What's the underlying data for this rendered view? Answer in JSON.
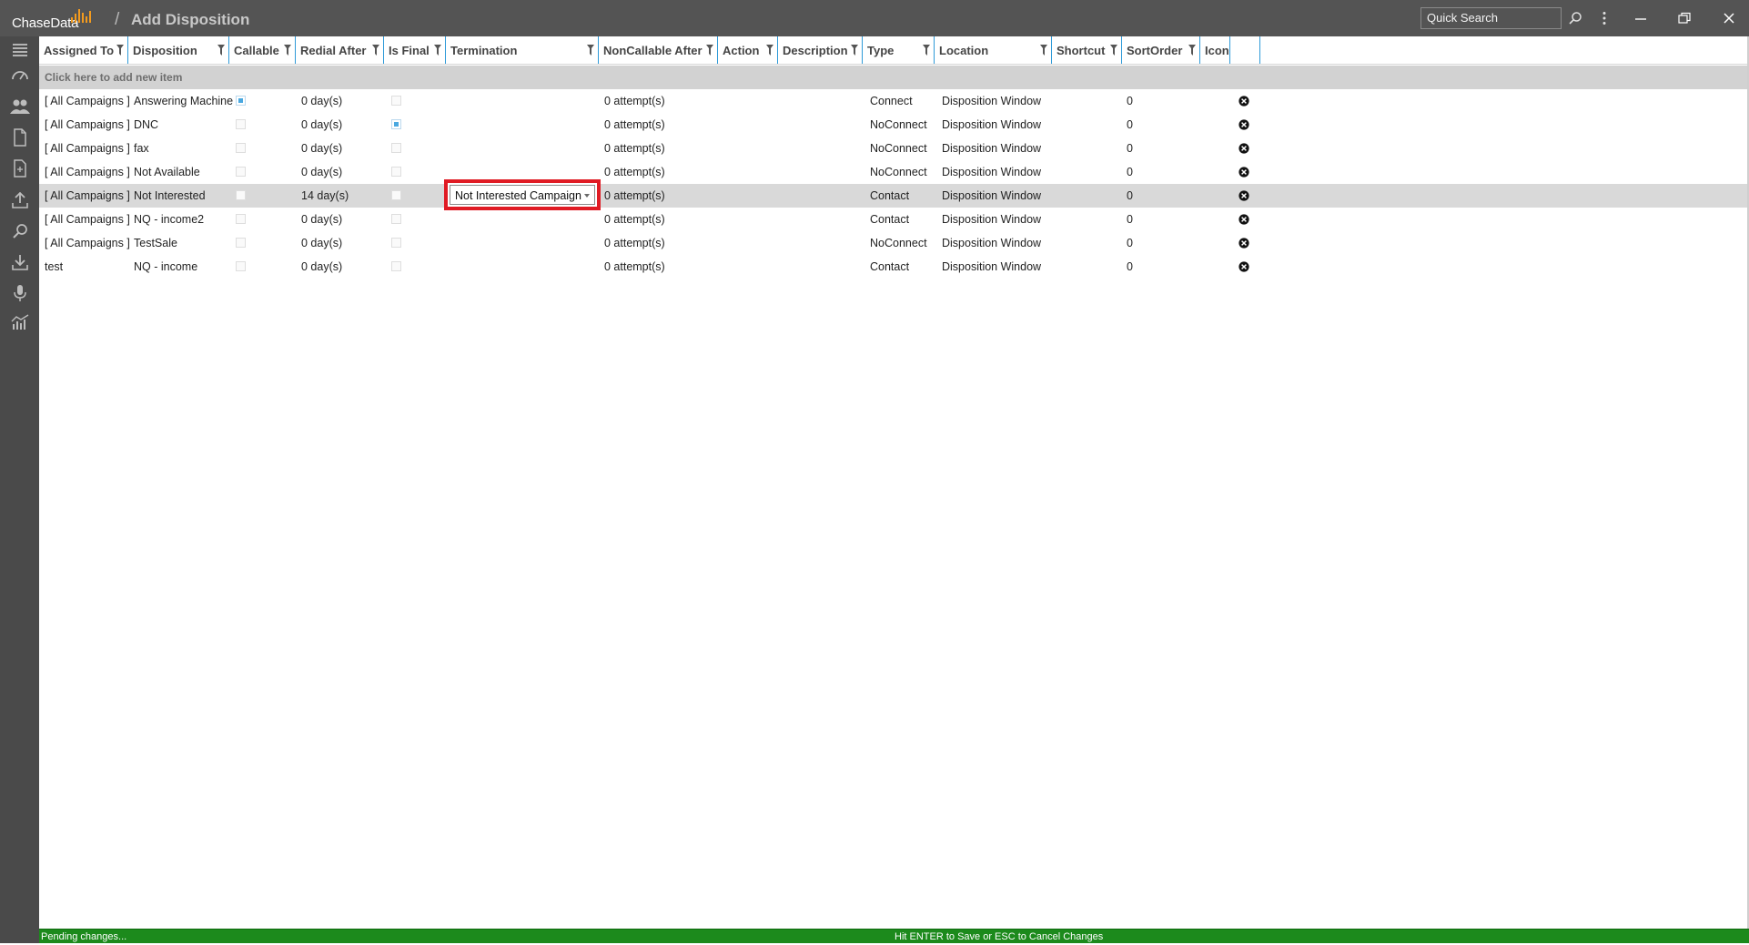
{
  "app": {
    "brand": "ChaseData",
    "breadcrumb_separator": "/",
    "page_title": "Add Disposition"
  },
  "header": {
    "quick_search_placeholder": "Quick Search"
  },
  "colors": {
    "titlebar": "#545454",
    "rail": "#4a4a4a",
    "accent_blue": "#2e9ad8",
    "highlight_red": "#e01b24",
    "status_green": "#1c8a1c",
    "logo_orange": "#f39b1e"
  },
  "rail_icons": [
    "menu-icon",
    "dashboard-icon",
    "users-icon",
    "document-icon",
    "report-icon",
    "upload-icon",
    "search-icon",
    "download-icon",
    "microphone-icon",
    "analytics-icon"
  ],
  "grid": {
    "columns": [
      "Assigned To",
      "Disposition",
      "Callable",
      "Redial After",
      "Is Final",
      "Termination",
      "NonCallable After",
      "Action",
      "Description",
      "Type",
      "Location",
      "Shortcut",
      "SortOrder",
      "Icon"
    ],
    "add_new_label": "Click here to add new item",
    "rows": [
      {
        "assigned_to": "[ All Campaigns ]",
        "disposition": "Answering Machine",
        "callable": true,
        "redial_after": "0 day(s)",
        "is_final": false,
        "termination": "",
        "noncallable_after": "0 attempt(s)",
        "type": "Connect",
        "location": "Disposition Window",
        "sort_order": "0"
      },
      {
        "assigned_to": "[ All Campaigns ]",
        "disposition": "DNC",
        "callable": false,
        "redial_after": "0 day(s)",
        "is_final": true,
        "termination": "",
        "noncallable_after": "0 attempt(s)",
        "type": "NoConnect",
        "location": "Disposition Window",
        "sort_order": "0"
      },
      {
        "assigned_to": "[ All Campaigns ]",
        "disposition": "fax",
        "callable": false,
        "redial_after": "0 day(s)",
        "is_final": false,
        "termination": "",
        "noncallable_after": "0 attempt(s)",
        "type": "NoConnect",
        "location": "Disposition Window",
        "sort_order": "0"
      },
      {
        "assigned_to": "[ All Campaigns ]",
        "disposition": "Not Available",
        "callable": false,
        "redial_after": "0 day(s)",
        "is_final": false,
        "termination": "",
        "noncallable_after": "0 attempt(s)",
        "type": "NoConnect",
        "location": "Disposition Window",
        "sort_order": "0"
      },
      {
        "assigned_to": "[ All Campaigns ]",
        "disposition": "Not Interested",
        "callable": false,
        "redial_after": "14 day(s)",
        "is_final": false,
        "termination": "Not Interested Campaign",
        "noncallable_after": "0 attempt(s)",
        "type": "Contact",
        "location": "Disposition Window",
        "sort_order": "0"
      },
      {
        "assigned_to": "[ All Campaigns ]",
        "disposition": "NQ - income2",
        "callable": false,
        "redial_after": "0 day(s)",
        "is_final": false,
        "termination": "",
        "noncallable_after": "0 attempt(s)",
        "type": "Contact",
        "location": "Disposition Window",
        "sort_order": "0"
      },
      {
        "assigned_to": "[ All Campaigns ]",
        "disposition": "TestSale",
        "callable": false,
        "redial_after": "0 day(s)",
        "is_final": false,
        "termination": "",
        "noncallable_after": "0 attempt(s)",
        "type": "NoConnect",
        "location": "Disposition Window",
        "sort_order": "0"
      },
      {
        "assigned_to": "test",
        "disposition": "NQ - income",
        "callable": false,
        "redial_after": "0 day(s)",
        "is_final": false,
        "termination": "",
        "noncallable_after": "0 attempt(s)",
        "type": "Contact",
        "location": "Disposition Window",
        "sort_order": "0"
      }
    ]
  },
  "status": {
    "left": "Pending changes...",
    "center": "Hit ENTER to Save or ESC to Cancel Changes"
  }
}
